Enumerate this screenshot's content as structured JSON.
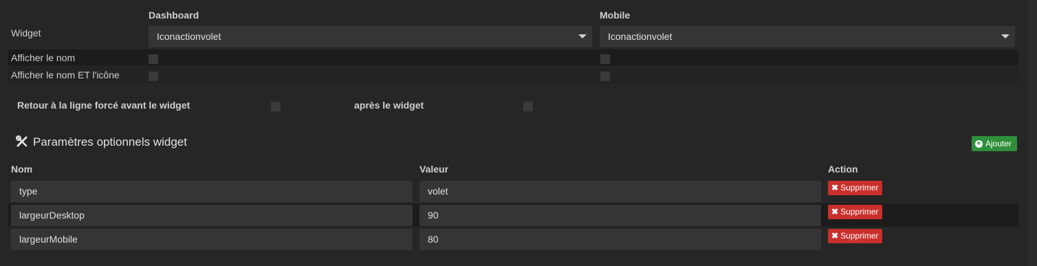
{
  "widget": {
    "label": "Widget",
    "dashboard_header": "Dashboard",
    "mobile_header": "Mobile",
    "dashboard_value": "Iconactionvolet",
    "mobile_value": "Iconactionvolet"
  },
  "options": {
    "show_name_label": "Afficher le nom",
    "show_name_icon_label": "Afficher le nom ET l'icône",
    "line_break_before_label": "Retour à la ligne forcé avant le widget",
    "line_break_after_label": "après le widget"
  },
  "params": {
    "title": "Paramètres optionnels widget",
    "add_label": "Ajouter",
    "col_name": "Nom",
    "col_value": "Valeur",
    "col_action": "Action",
    "delete_label": "Supprimer",
    "rows": [
      {
        "name": "type",
        "value": "volet"
      },
      {
        "name": "largeurDesktop",
        "value": "90"
      },
      {
        "name": "largeurMobile",
        "value": "80"
      }
    ]
  },
  "colors": {
    "background": "#262626",
    "band": "#1c1c1c",
    "add_button": "#2f8f3a",
    "delete_button": "#c9302c"
  },
  "icons": {
    "params_title": "tools-icon",
    "add": "plus-circle-icon",
    "delete": "close-icon",
    "dropdown": "caret-down-icon"
  }
}
